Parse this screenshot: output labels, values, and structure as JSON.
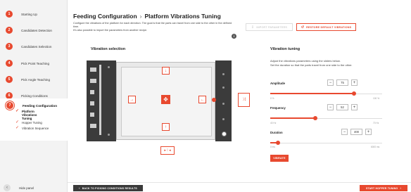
{
  "sidebar": {
    "steps": [
      {
        "num": "1",
        "label": "Starting Up"
      },
      {
        "num": "2",
        "label": "Candidates Detection"
      },
      {
        "num": "3",
        "label": "Candidates Selection"
      },
      {
        "num": "4",
        "label": "Pick Point Teaching"
      },
      {
        "num": "5",
        "label": "Pick Angle Teaching"
      },
      {
        "num": "6",
        "label": "Picking Conditions"
      },
      {
        "num": "7",
        "label": "Feeding Configuration"
      }
    ],
    "substeps": [
      {
        "label": "Platform Vibrations Tuning",
        "check": "✓"
      },
      {
        "label": "Hopper Tuning",
        "check": "✓"
      },
      {
        "label": "Vibration Sequence",
        "check": "✓"
      }
    ],
    "hide_panel": {
      "icon": "‹",
      "label": "Hide panel"
    }
  },
  "header": {
    "title": "Feeding Configuration",
    "separator": "›",
    "subtitle": "Platform Vibrations Tuning",
    "description_1": "Configure the vibrations of the platform for each direction. The goal is that the parts can travel from one side to the other in the defined time.",
    "description_2": "It's also possible to import the parameters from another recipe.",
    "info_icon": "i"
  },
  "toolbar": {
    "import_label": "IMPORT PARAMETERS",
    "import_icon": "⇩",
    "restore_label": "RESTORE DEFAULT VIBRATIONS",
    "restore_icon": "↺"
  },
  "vibration_selection": {
    "title": "Vibration selection",
    "arrows": {
      "up": "↓",
      "down": "↑",
      "left": "→",
      "right": "←",
      "center": "✥",
      "side": "⤨",
      "bottom": "▸ ⁞ ◂"
    }
  },
  "tuning": {
    "title": "Vibration tuning",
    "description_1": "Adjust the vibrations parameters using the sliders below.",
    "description_2": "Set the duration so that the parts travel from one side to the other.",
    "amplitude": {
      "label": "Amplitude",
      "value": "75",
      "min": "0 %",
      "max": "100 %",
      "fraction": 0.75
    },
    "frequency": {
      "label": "Frequency",
      "value": "52",
      "min": "40 Hz",
      "max": "70 Hz",
      "fraction": 0.4
    },
    "duration": {
      "label": "Duration",
      "value": "400",
      "min": "0 ms",
      "max": "6000 ms",
      "fraction": 0.067
    },
    "minus": "−",
    "plus": "+",
    "vibrate_label": "VIBRATE"
  },
  "footer": {
    "back_label": "BACK TO PICKING CONDITIONS RESULTS",
    "back_icon": "‹",
    "start_label": "START HOPPER TUNING",
    "start_icon": "›"
  },
  "colors": {
    "accent": "#e8492f",
    "dark": "#3a3a3a",
    "sidebar_bg": "#f3f3f3"
  }
}
